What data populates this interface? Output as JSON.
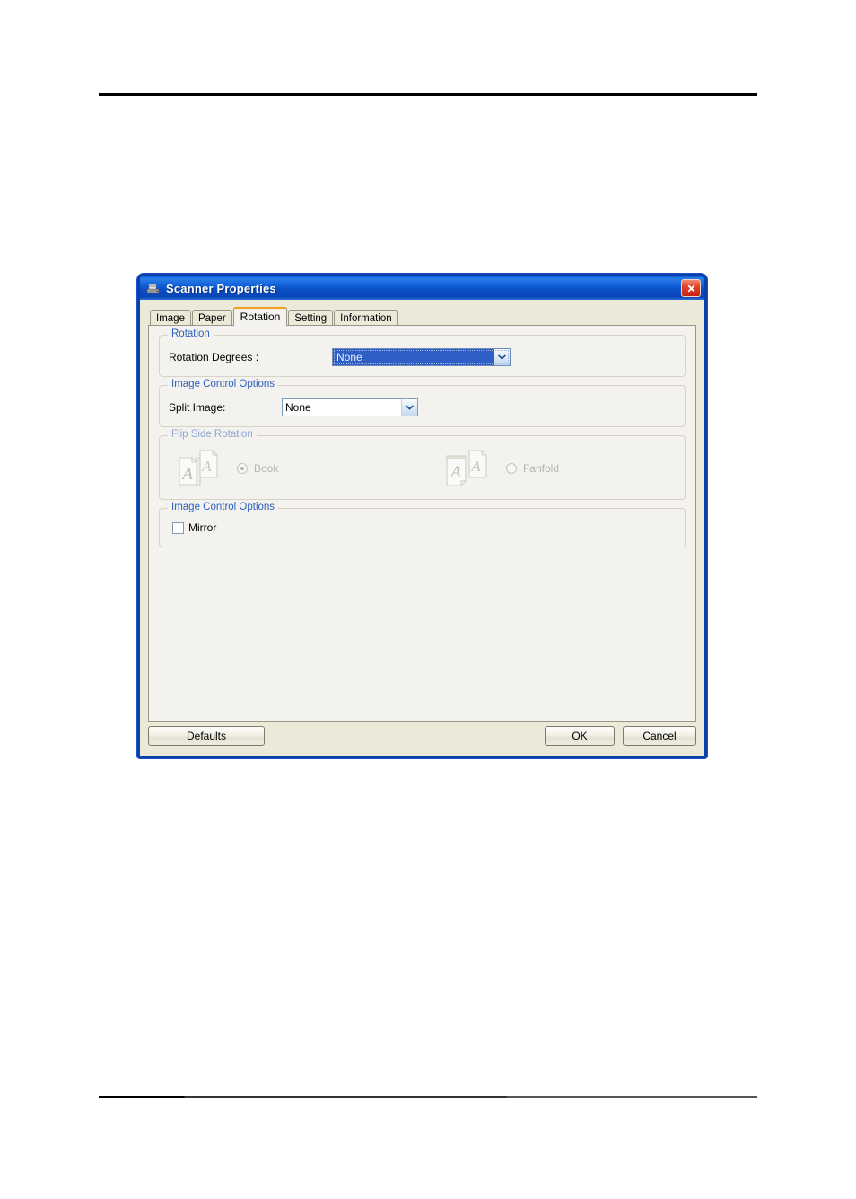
{
  "document": {
    "header_rule": true,
    "footer_rule": true
  },
  "dialog": {
    "title": "Scanner Properties",
    "title_icon": "scanner-icon",
    "close_icon": "close-icon",
    "tabs": [
      {
        "label": "Image",
        "active": false
      },
      {
        "label": "Paper",
        "active": false
      },
      {
        "label": "Rotation",
        "active": true
      },
      {
        "label": "Setting",
        "active": false
      },
      {
        "label": "Information",
        "active": false
      }
    ],
    "groups": {
      "rotation": {
        "legend": "Rotation",
        "field_label": "Rotation Degrees :",
        "value": "None",
        "focused": true,
        "options": [
          "None"
        ]
      },
      "split": {
        "legend": "Image Control Options",
        "field_label": "Split Image:",
        "value": "None",
        "focused": false,
        "options": [
          "None"
        ]
      },
      "flip_side": {
        "legend": "Flip Side Rotation",
        "disabled": true,
        "options": [
          {
            "label": "Book",
            "selected": true,
            "icon": "book-pages-icon"
          },
          {
            "label": "Fanfold",
            "selected": false,
            "icon": "fanfold-pages-icon"
          }
        ]
      },
      "mirror": {
        "legend": "Image Control Options",
        "checkbox_label": "Mirror",
        "checked": false
      }
    },
    "buttons": {
      "defaults": "Defaults",
      "ok": "OK",
      "cancel": "Cancel"
    }
  },
  "colors": {
    "titlebar_blue": "#0a4ec4",
    "dialog_border": "#0b3fa8",
    "dialog_face": "#ece9d8",
    "panel_face": "#f3f2ee",
    "group_legend": "#2b5fbe",
    "active_tab_accent": "#f0a21c",
    "selection_blue": "#2f5fc4",
    "close_red": "#c5230f",
    "disabled_text": "#b5b5ad"
  }
}
